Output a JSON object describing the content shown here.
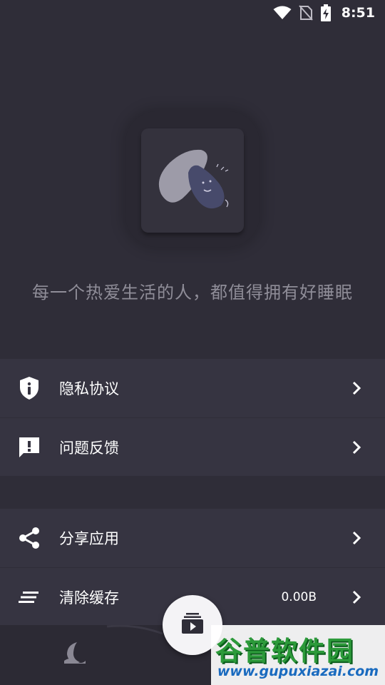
{
  "status_bar": {
    "time": "8:51",
    "icons": [
      "wifi-icon",
      "no-sim-icon",
      "battery-charging-icon"
    ]
  },
  "app_icon": {
    "name": "app-logo"
  },
  "slogan": "每一个热爱生活的人，都值得拥有好睡眠",
  "menu_group_1": [
    {
      "label": "隐私协议",
      "icon": "shield-info-icon"
    },
    {
      "label": "问题反馈",
      "icon": "feedback-icon"
    }
  ],
  "menu_group_2": [
    {
      "label": "分享应用",
      "icon": "share-icon"
    },
    {
      "label": "清除缓存",
      "icon": "clear-cache-icon",
      "value": "0.00B"
    }
  ],
  "bottom_nav": {
    "left_icon": "moon-icon",
    "center_icon": "playlist-play-icon"
  },
  "watermark": {
    "title": "谷普软件园",
    "url": "www.gupuxiazai.com"
  },
  "colors": {
    "background": "#2f2d38",
    "row_background": "#363441",
    "slogan": "#8f8d98",
    "watermark_green": "#2c9a3a",
    "watermark_blue": "#1a6bbf"
  }
}
